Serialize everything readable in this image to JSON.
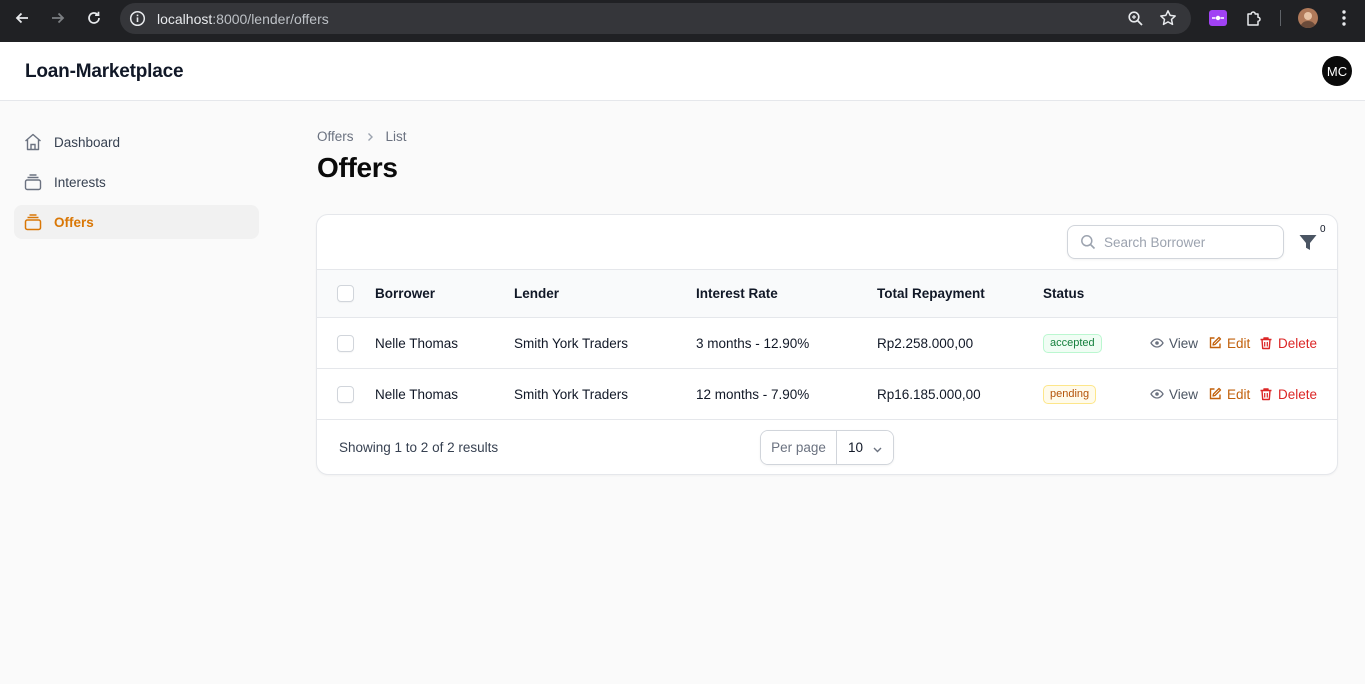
{
  "browser": {
    "url_host": "localhost",
    "url_path": ":8000/lender/offers"
  },
  "header": {
    "brand": "Loan-Marketplace",
    "avatar_initials": "MC"
  },
  "sidebar": {
    "items": [
      {
        "label": "Dashboard",
        "icon": "home-icon",
        "active": false
      },
      {
        "label": "Interests",
        "icon": "stack-icon",
        "active": false
      },
      {
        "label": "Offers",
        "icon": "stack-icon",
        "active": true
      }
    ]
  },
  "breadcrumb": {
    "parent": "Offers",
    "current": "List"
  },
  "page": {
    "title": "Offers"
  },
  "table": {
    "search_placeholder": "Search Borrower",
    "filter_count": "0",
    "columns": [
      "Borrower",
      "Lender",
      "Interest Rate",
      "Total Repayment",
      "Status"
    ],
    "rows": [
      {
        "borrower": "Nelle Thomas",
        "lender": "Smith York Traders",
        "interest_rate": "3 months - 12.90%",
        "total_repayment": "Rp2.258.000,00",
        "status": "accepted"
      },
      {
        "borrower": "Nelle Thomas",
        "lender": "Smith York Traders",
        "interest_rate": "12 months - 7.90%",
        "total_repayment": "Rp16.185.000,00",
        "status": "pending"
      }
    ],
    "actions": {
      "view": "View",
      "edit": "Edit",
      "delete": "Delete"
    },
    "footer": {
      "showing": "Showing 1 to 2 of 2 results",
      "per_page_label": "Per page",
      "per_page_value": "10"
    }
  },
  "colors": {
    "accent": "#d97706",
    "accepted": "#15803d",
    "pending": "#b45309",
    "delete": "#dc2626"
  }
}
